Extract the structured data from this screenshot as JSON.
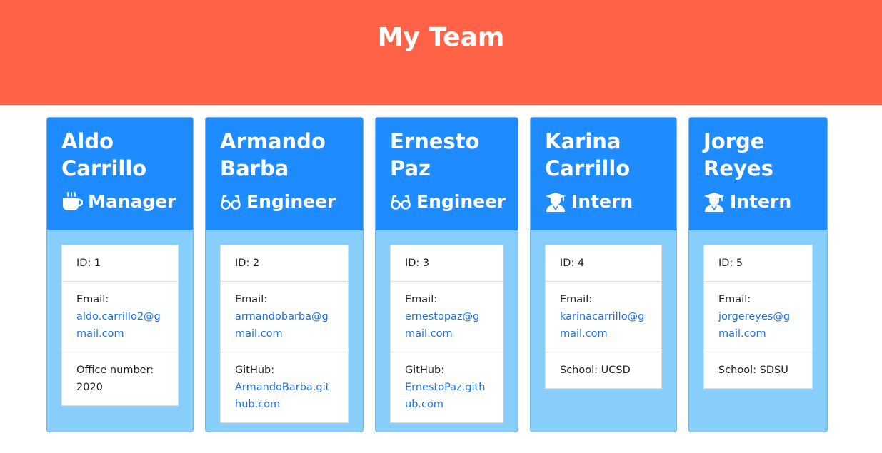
{
  "header": {
    "title": "My Team"
  },
  "team": [
    {
      "name": "Aldo Carrillo",
      "role": "Manager",
      "icon": "mug-icon",
      "id_text": "ID: 1",
      "email_label": "Email:",
      "email": "aldo.carrillo2@gmail.com",
      "extra_label": "Office number:",
      "extra_value": "2020"
    },
    {
      "name": "Armando Barba",
      "role": "Engineer",
      "icon": "glasses-icon",
      "id_text": "ID: 2",
      "email_label": "Email:",
      "email": "armandobarba@gmail.com",
      "extra_label": "GitHub:",
      "extra_value": "ArmandoBarba.github.com"
    },
    {
      "name": "Ernesto Paz",
      "role": "Engineer",
      "icon": "glasses-icon",
      "id_text": "ID: 3",
      "email_label": "Email:",
      "email": "ernestopaz@gmail.com",
      "extra_label": "GitHub:",
      "extra_value": "ErnestoPaz.github.com"
    },
    {
      "name": "Karina Carrillo",
      "role": "Intern",
      "icon": "graduate-icon",
      "id_text": "ID: 4",
      "email_label": "Email:",
      "email": "karinacarrillo@gmail.com",
      "extra_text": "School: UCSD"
    },
    {
      "name": "Jorge Reyes",
      "role": "Intern",
      "icon": "graduate-icon",
      "id_text": "ID: 5",
      "email_label": "Email:",
      "email": "jorgereyes@gmail.com",
      "extra_text": "School: SDSU"
    }
  ],
  "colors": {
    "header_bg": "#ff6347",
    "card_head_bg": "#1e8cff",
    "card_body_bg": "#87cefa",
    "link": "#1a73e8"
  }
}
